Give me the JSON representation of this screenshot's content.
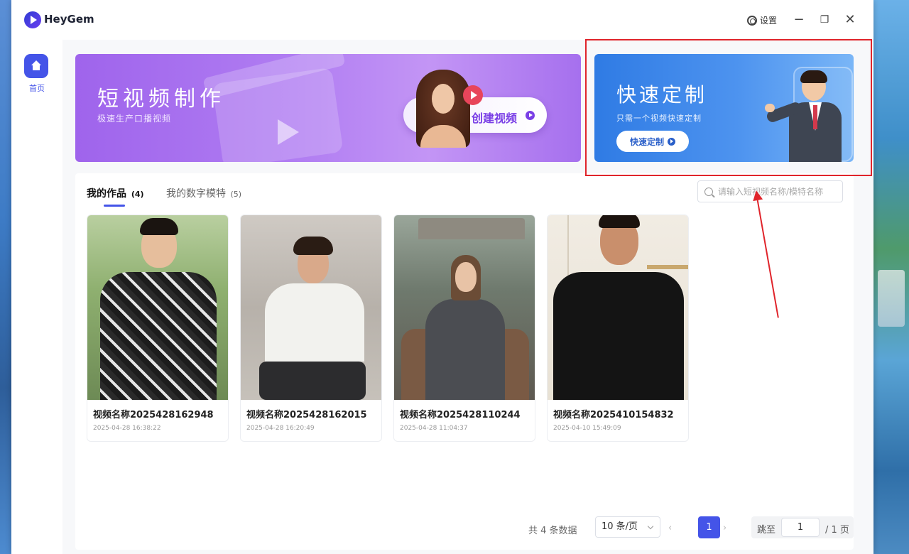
{
  "app": {
    "name": "HeyGem"
  },
  "titlebar": {
    "settings_label": "设置"
  },
  "sidebar": {
    "home_label": "首页"
  },
  "banners": {
    "short_video": {
      "title": "短视频制作",
      "subtitle": "极速生产口播视频",
      "button": "创建视频"
    },
    "quick_custom": {
      "title": "快速定制",
      "subtitle": "只需一个视频快速定制",
      "button": "快速定制"
    }
  },
  "tabs": [
    {
      "label": "我的作品",
      "count": "(4)",
      "active": true
    },
    {
      "label": "我的数字模特",
      "count": "(5)",
      "active": false
    }
  ],
  "search": {
    "placeholder": "请输入短视频名称/模特名称",
    "value": ""
  },
  "works": [
    {
      "title": "视频名称2025428162948",
      "date": "2025-04-28 16:38:22"
    },
    {
      "title": "视频名称2025428162015",
      "date": "2025-04-28 16:20:49"
    },
    {
      "title": "视频名称2025428110244",
      "date": "2025-04-28 11:04:37"
    },
    {
      "title": "视频名称2025410154832",
      "date": "2025-04-10 15:49:09"
    }
  ],
  "pagination": {
    "total_text": "共 4 条数据",
    "page_size": "10 条/页",
    "current_page": "1",
    "jump_label": "跳至",
    "jump_value": "1",
    "total_pages": "/ 1 页"
  },
  "colors": {
    "accent": "#4454e8",
    "purple_banner": "#a670ee",
    "blue_banner": "#2f7be4",
    "annotation_red": "#e0242b"
  }
}
